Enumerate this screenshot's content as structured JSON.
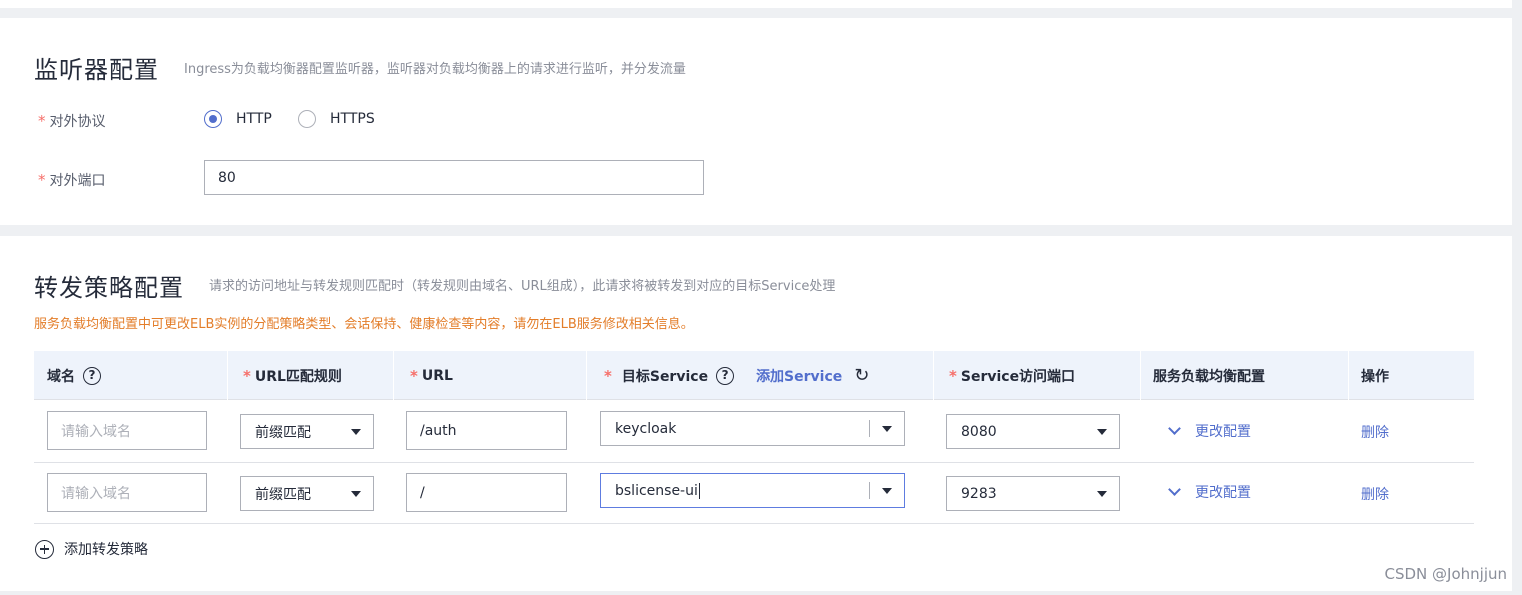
{
  "listener": {
    "title": "监听器配置",
    "desc": "Ingress为负载均衡器配置监听器，监听器对负载均衡器上的请求进行监听，并分发流量",
    "protocol_label": "对外协议",
    "protocol_options": [
      "HTTP",
      "HTTPS"
    ],
    "protocol_selected": "HTTP",
    "port_label": "对外端口",
    "port_value": "80"
  },
  "forward": {
    "title": "转发策略配置",
    "desc": "请求的访问地址与转发规则匹配时（转发规则由域名、URL组成），此请求将被转发到对应的目标Service处理",
    "warning": "服务负载均衡配置中可更改ELB实例的分配策略类型、会话保持、健康检查等内容，请勿在ELB服务修改相关信息。",
    "columns": {
      "domain": "域名",
      "match_rule": "URL匹配规则",
      "url": "URL",
      "target_service": "目标Service",
      "add_service": "添加Service",
      "service_port": "Service访问端口",
      "lb_config": "服务负载均衡配置",
      "actions": "操作"
    },
    "rows": [
      {
        "domain_placeholder": "请输入域名",
        "match_rule": "前缀匹配",
        "url": "/auth",
        "service": "keycloak",
        "port": "8080",
        "lb_config": "更改配置",
        "delete": "删除"
      },
      {
        "domain_placeholder": "请输入域名",
        "match_rule": "前缀匹配",
        "url": "/",
        "service": "bslicense-ui",
        "port": "9283",
        "lb_config": "更改配置",
        "delete": "删除"
      }
    ],
    "add_rule": "添加转发策略"
  },
  "watermark": "CSDN @Johnjjun",
  "colors": {
    "accent": "#526ecc",
    "required": "#f66f6a",
    "warning": "#e37d29",
    "header_bg": "#eef3fb"
  },
  "icons": {
    "help": "question-circle-icon",
    "refresh": "refresh-icon",
    "caret": "caret-down-icon",
    "chevron": "chevron-down-icon",
    "add": "plus-circle-icon"
  }
}
